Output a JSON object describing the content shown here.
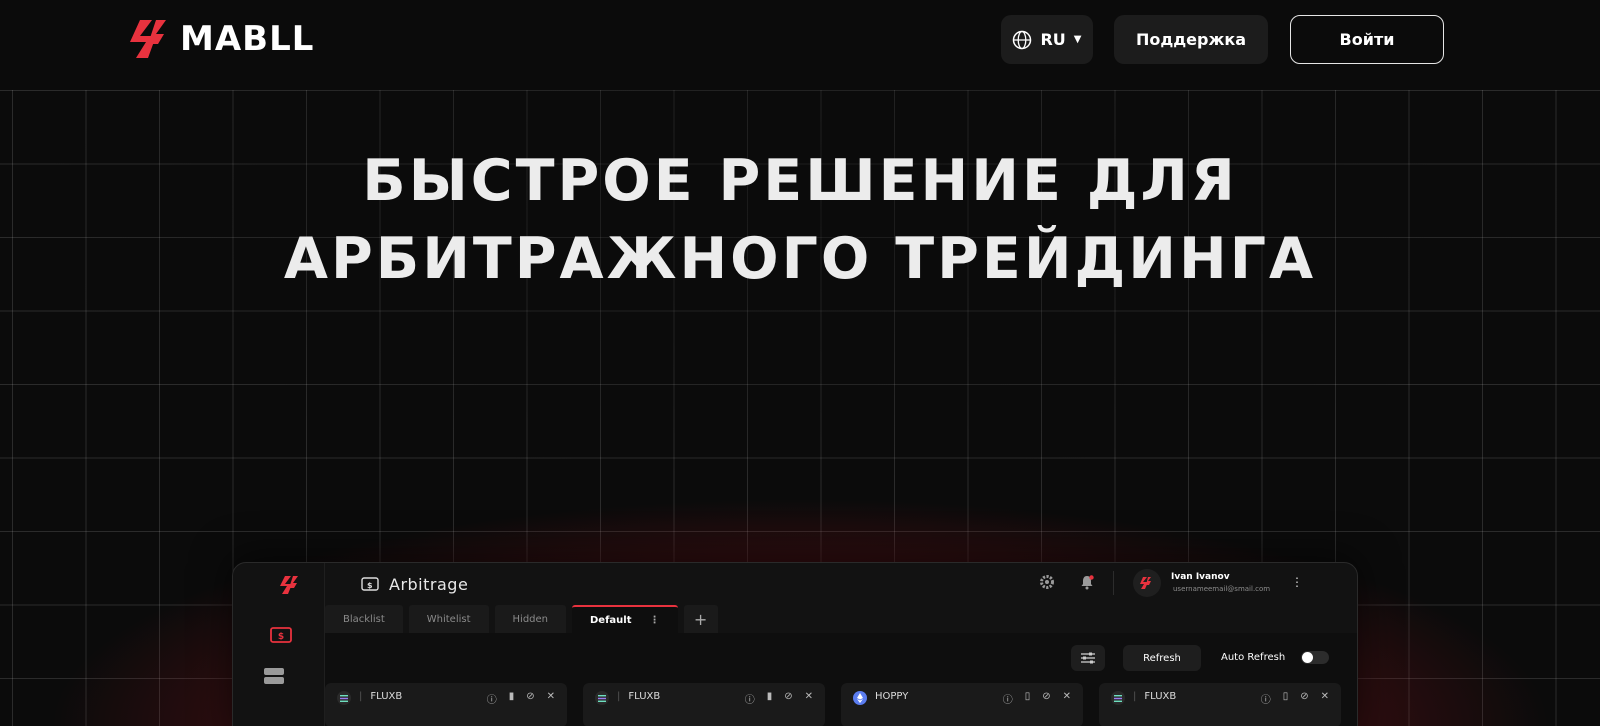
{
  "header": {
    "brand": "MABLL",
    "lang": "RU",
    "support_label": "Поддержка",
    "login_label": "Войти"
  },
  "hero": {
    "line1": "БЫСТРОЕ РЕШЕНИЕ ДЛЯ",
    "line2": "АРБИТРАЖНОГО ТРЕЙДИНГА"
  },
  "app": {
    "title": "Arbitrage",
    "user": {
      "name": "Ivan Ivanov",
      "email": "usernameemail@smail.com"
    },
    "tabs": [
      {
        "label": "Blacklist"
      },
      {
        "label": "Whitelist"
      },
      {
        "label": "Hidden"
      },
      {
        "label": "Default"
      }
    ],
    "refresh_label": "Refresh",
    "auto_refresh_label": "Auto Refresh",
    "cards": [
      {
        "ticker": "FLUXB"
      },
      {
        "ticker": "FLUXB"
      },
      {
        "ticker": "HOPPY"
      },
      {
        "ticker": "FLUXB"
      }
    ]
  },
  "colors": {
    "accent": "#e8323e",
    "background": "#0b0b0b"
  }
}
